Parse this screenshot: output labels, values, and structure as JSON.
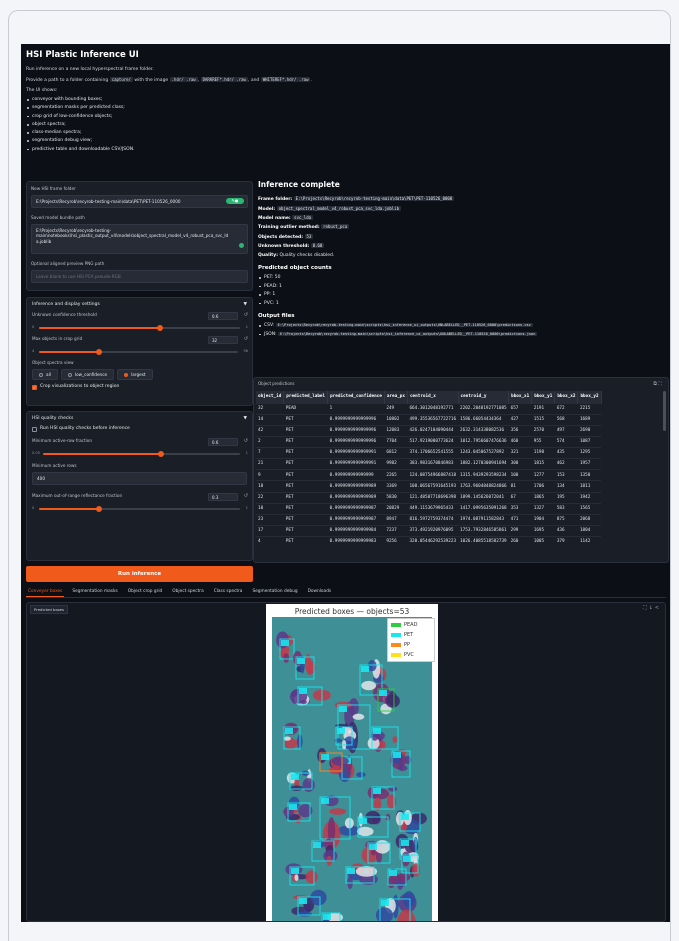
{
  "app": {
    "title": "HSI Plastic Inference UI"
  },
  "intro": {
    "line1": "Run inference on a new local hyperspectral frame folder.",
    "line2_pre": "Provide a path to a folder containing ",
    "line2_code1": "capture/",
    "line2_mid": " with the image ",
    "line2_code2": ".hdr/ .raw",
    "line2_sep1": ", ",
    "line2_code3": "DARKREF*.hdr/ .raw",
    "line2_sep2": ", and ",
    "line2_code4": "WHITEREF*.hdr/ .raw",
    "line2_end": ".",
    "shows_label": "The UI shows:",
    "items": [
      "conveyor with bounding boxes;",
      "segmentation masks per predicted class;",
      "crop grid of low-confidence objects;",
      "object spectra;",
      "class-median spectra;",
      "segmentation debug view;",
      "predictive table and downloadable CSV/JSON."
    ]
  },
  "form": {
    "frame_label": "New HSI frame folder",
    "frame_value": "E:\\Projects\\Recyrob\\recyrob-testing-main\\data\\PET\\PET-110526_0000",
    "bundle_label": "Saved model bundle path",
    "bundle_value": "E:\\Projects\\Recyrob\\recyrob-testing-main\\notebooks\\hsi_plastic_output_v4\\models\\object_spectral_model_v4_robust_pca_svc_ld a.joblib",
    "preview_label": "Optional aligned preview PNG path",
    "preview_placeholder": "Leave blank to use HSI PCA pseudo-RGB"
  },
  "settings": {
    "title": "Inference and display settings",
    "unknown_label": "Unknown confidence threshold",
    "unknown_value": "0.6",
    "unknown_min": "0",
    "unknown_max": "1",
    "unknown_fraction": 0.6,
    "maxcrop_label": "Max objects in crop grid",
    "maxcrop_value": "32",
    "maxcrop_min": "4",
    "maxcrop_max": "96",
    "maxcrop_fraction": 0.3,
    "spectra_label": "Object spectra view",
    "opts": [
      "all",
      "low_confidence",
      "largest"
    ],
    "selected": "largest",
    "crop_label": "Crop visualizations to object region"
  },
  "quality": {
    "title": "HSI quality checks",
    "run_label": "Run HSI quality checks before inference",
    "minrow_label": "Minimum active-row fraction",
    "minrow_value": "0.6",
    "minrow_min": "0.05",
    "minrow_max": "1",
    "minrow_fraction": 0.6,
    "minrows_label": "Minimum active rows",
    "minrows_value": "400",
    "maxoor_label": "Maximum out-of-range reflectance fraction",
    "maxoor_value": "0.3",
    "maxoor_min": "0",
    "maxoor_max": "1",
    "maxoor_fraction": 0.3
  },
  "run_button": "Run inference",
  "result": {
    "title": "Inference complete",
    "k_folder": "Frame folder:",
    "v_folder": "E:\\Projects\\Recyrob\\recyrob-testing-main\\data\\PET\\PET-110526_0000",
    "k_model": "Model:",
    "v_model": "object_spectral_model_v4_robust_pca_svc_lda.joblib",
    "k_name": "Model name:",
    "v_name": "svc_lda",
    "k_outlier": "Training outlier method:",
    "v_outlier": "robust_pca",
    "k_detected": "Objects detected:",
    "v_detected": "53",
    "k_thresh": "Unknown threshold:",
    "v_thresh": "0.60",
    "k_quality": "Quality:",
    "v_quality": "Quality checks disabled.",
    "counts_title": "Predicted object counts",
    "counts": [
      "PET: 50",
      "PEAD: 1",
      "PP: 1",
      "PVC: 1"
    ],
    "output_title": "Output files",
    "csv_k": "CSV:",
    "csv_v": "E:\\Projects\\Recyrob\\recyrob-testing-main\\scripts\\hsi_inference_ui_outputs\\UNLABELLED__PET-110526_0000\\predictions.csv",
    "json_k": "JSON:",
    "json_v": "E:\\Projects\\Recyrob\\recyrob-testing-main\\scripts\\hsi_inference_ui_outputs\\UNLABELLED__PET-110526_0000\\predictions.json"
  },
  "table": {
    "caption": "Object predictions",
    "columns": [
      "object_id",
      "predicted_label",
      "predicted_confidence",
      "area_px",
      "centroid_x",
      "centroid_y",
      "bbox_x1",
      "bbox_y1",
      "bbox_x2",
      "bbox_y2"
    ],
    "rows": [
      [
        "32",
        "PEAD",
        "1",
        "249",
        "664.3012048192771",
        "2202.2048192771085",
        "657",
        "2191",
        "672",
        "2215"
      ],
      [
        "14",
        "PET",
        "0.9999999999999996",
        "10802",
        "499.35536567722716",
        "1586.66054434364",
        "427",
        "1515",
        "568",
        "1689"
      ],
      [
        "42",
        "PET",
        "0.9999999999999996",
        "12083",
        "426.0247104090444",
        "2632.314338082536",
        "356",
        "2570",
        "497",
        "2690"
      ],
      [
        "2",
        "PET",
        "0.9999999999999996",
        "7704",
        "517.9219080773624",
        "1012.7956607476636",
        "460",
        "955",
        "574",
        "1087"
      ],
      [
        "7",
        "PET",
        "0.9999999999999991",
        "6812",
        "374.1706652541555",
        "1243.045067527892",
        "321",
        "1198",
        "435",
        "1295"
      ],
      [
        "21",
        "PET",
        "0.9999999999999991",
        "9982",
        "383.9831670846983",
        "1882.1270300941694",
        "300",
        "1815",
        "462",
        "1957"
      ],
      [
        "9",
        "PET",
        "0.999999999999999",
        "2265",
        "124.08754966887418",
        "1315.9439293598234",
        "100",
        "1277",
        "153",
        "1350"
      ],
      [
        "18",
        "PET",
        "0.9999999999999989",
        "3369",
        "108.06567591645193",
        "1763.9604848824866",
        "81",
        "1706",
        "134",
        "1811"
      ],
      [
        "22",
        "PET",
        "0.9999999999999989",
        "5830",
        "121.48507718696398",
        "1899.145626072041",
        "67",
        "1865",
        "195",
        "1942"
      ],
      [
        "10",
        "PET",
        "0.9999999999999987",
        "20829",
        "449.1153679965433",
        "1417.0995635091268",
        "353",
        "1327",
        "583",
        "1565"
      ],
      [
        "23",
        "PET",
        "0.9999999999999987",
        "8947",
        "816.5972759374474",
        "1974.087911582843",
        "471",
        "1904",
        "875",
        "2068"
      ],
      [
        "17",
        "PET",
        "0.9999999999999984",
        "7237",
        "373.4921920976095",
        "1753.7932846585861",
        "299",
        "1695",
        "436",
        "1804"
      ],
      [
        "4",
        "PET",
        "0.9999999999999983",
        "9256",
        "320.05446292539223",
        "1026.4085518582739",
        "260",
        "1005",
        "379",
        "1142"
      ]
    ]
  },
  "tabs": [
    "Conveyor boxes",
    "Segmentation masks",
    "Object crop grid",
    "Object spectra",
    "Class spectra",
    "Segmentation debug",
    "Downloads"
  ],
  "active_tab": "Conveyor boxes",
  "figure": {
    "tag": "Predicted boxes",
    "title": "Predicted boxes — objects=53",
    "legend": [
      {
        "name": "PEAD",
        "color": "#2ecc40"
      },
      {
        "name": "PET",
        "color": "#19e6f0"
      },
      {
        "name": "PP",
        "color": "#ff8a1a"
      },
      {
        "name": "PVC",
        "color": "#ffe01a"
      }
    ],
    "box_label": "PET\n1.00"
  },
  "colors": {
    "accent": "#f05a1a",
    "bg": "#0c0f16",
    "panel": "#1a1e27"
  }
}
